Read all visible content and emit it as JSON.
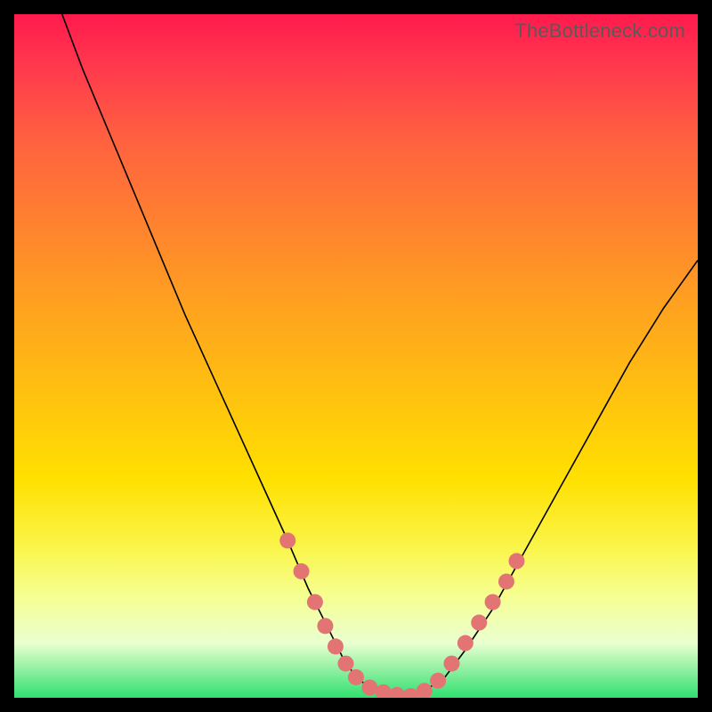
{
  "watermark_text": "TheBottleneck.com",
  "chart_data": {
    "type": "line",
    "title": "",
    "xlabel": "",
    "ylabel": "",
    "xlim": [
      0,
      100
    ],
    "ylim": [
      0,
      100
    ],
    "grid": false,
    "legend": false,
    "series": [
      {
        "name": "left-arm",
        "x": [
          7,
          10,
          15,
          20,
          25,
          30,
          35,
          40,
          43,
          46,
          48,
          50,
          52,
          54,
          56,
          58
        ],
        "y": [
          100,
          92,
          80,
          68,
          56,
          45,
          34,
          23,
          16,
          10,
          6,
          3,
          1.5,
          0.8,
          0.4,
          0.2
        ]
      },
      {
        "name": "right-arm",
        "x": [
          58,
          60,
          63,
          66,
          70,
          75,
          80,
          85,
          90,
          95,
          100
        ],
        "y": [
          0.2,
          1,
          3,
          7,
          13,
          22,
          31,
          40,
          49,
          57,
          64
        ]
      }
    ],
    "highlight_dots": [
      {
        "x": 40,
        "y": 23
      },
      {
        "x": 42,
        "y": 18.5
      },
      {
        "x": 44,
        "y": 14
      },
      {
        "x": 45.5,
        "y": 10.5
      },
      {
        "x": 47,
        "y": 7.5
      },
      {
        "x": 48.5,
        "y": 5
      },
      {
        "x": 50,
        "y": 3
      },
      {
        "x": 52,
        "y": 1.5
      },
      {
        "x": 54,
        "y": 0.8
      },
      {
        "x": 56,
        "y": 0.4
      },
      {
        "x": 58,
        "y": 0.25
      },
      {
        "x": 60,
        "y": 1
      },
      {
        "x": 62,
        "y": 2.5
      },
      {
        "x": 64,
        "y": 5
      },
      {
        "x": 66,
        "y": 8
      },
      {
        "x": 68,
        "y": 11
      },
      {
        "x": 70,
        "y": 14
      },
      {
        "x": 72,
        "y": 17
      },
      {
        "x": 73.5,
        "y": 20
      }
    ]
  }
}
